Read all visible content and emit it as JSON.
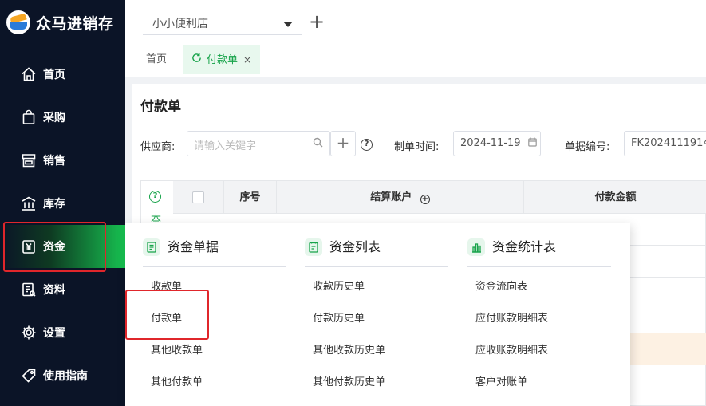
{
  "app": {
    "name": "众马进销存"
  },
  "sidebar": {
    "items": [
      {
        "label": "首页",
        "icon": "home-icon"
      },
      {
        "label": "采购",
        "icon": "shopping-bag-icon"
      },
      {
        "label": "销售",
        "icon": "store-icon"
      },
      {
        "label": "库存",
        "icon": "warehouse-icon"
      },
      {
        "label": "资金",
        "icon": "yen-icon",
        "active": true
      },
      {
        "label": "资料",
        "icon": "document-icon"
      },
      {
        "label": "设置",
        "icon": "gear-icon"
      },
      {
        "label": "使用指南",
        "icon": "tag-icon"
      }
    ],
    "active_color": "#17c251"
  },
  "topbar": {
    "store": "小小便利店",
    "add_label": "+"
  },
  "tabs": [
    {
      "label": "首页"
    },
    {
      "label": "付款单",
      "active": true,
      "close": "×"
    }
  ],
  "page": {
    "title": "付款单",
    "filters": {
      "supplier_label": "供应商:",
      "supplier_placeholder": "请输入关键字",
      "date_label": "制单时间:",
      "date_value": "2024-11-19",
      "doc_no_label": "单据编号:",
      "doc_no_value": "FK2024111914"
    },
    "table": {
      "help_text": "本",
      "columns": [
        "序号",
        "结算账户",
        "付款金额"
      ]
    }
  },
  "dropdown": {
    "columns": [
      {
        "title": "资金单据",
        "icon": "receipt-icon",
        "items": [
          "收款单",
          "付款单",
          "其他收款单",
          "其他付款单"
        ]
      },
      {
        "title": "资金列表",
        "icon": "list-icon",
        "items": [
          "收款历史单",
          "付款历史单",
          "其他收款历史单",
          "其他付款历史单"
        ]
      },
      {
        "title": "资金统计表",
        "icon": "bar-chart-icon",
        "items": [
          "资金流向表",
          "应付账款明细表",
          "应收账款明细表",
          "客户对账单"
        ]
      }
    ]
  },
  "colors": {
    "accent": "#17a34a",
    "sidebar_bg": "#0b1427",
    "highlight_box": "#e0262b"
  }
}
